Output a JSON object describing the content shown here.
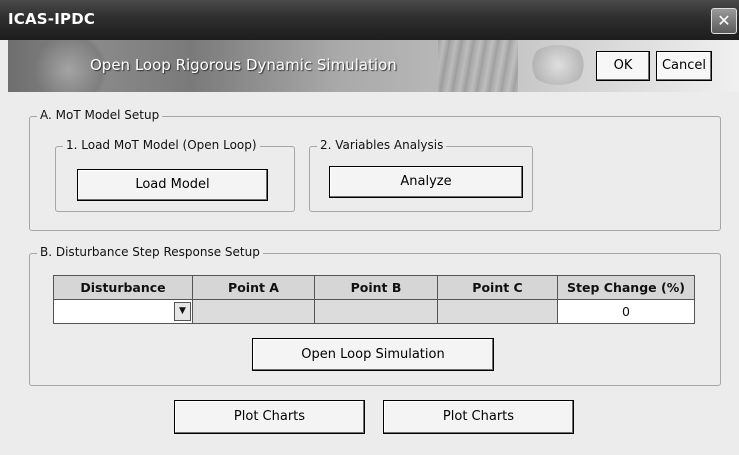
{
  "window": {
    "title": "ICAS-IPDC",
    "close_label": "✕"
  },
  "banner": {
    "title": "Open Loop Rigorous Dynamic Simulation",
    "ok_label": "OK",
    "cancel_label": "Cancel"
  },
  "section_a": {
    "legend": "A. MoT Model Setup",
    "load": {
      "legend": "1. Load MoT Model (Open Loop)",
      "button_label": "Load Model"
    },
    "analysis": {
      "legend": "2. Variables Analysis",
      "button_label": "Analyze"
    }
  },
  "section_b": {
    "legend": "B. Disturbance Step Response Setup",
    "columns": [
      "Disturbance",
      "Point A",
      "Point B",
      "Point C",
      "Step Change (%)"
    ],
    "row": {
      "disturbance": "",
      "point_a": "",
      "point_b": "",
      "point_c": "",
      "step_change": "0"
    },
    "simulate_label": "Open Loop Simulation"
  },
  "footer": {
    "plot1_label": "Plot Charts",
    "plot2_label": "Plot Charts"
  },
  "colors": {
    "title_bar": "#2e2e2e",
    "dialog_bg": "#ececec",
    "header_cell": "#d6d6d6"
  },
  "icons": {
    "close": "close-icon",
    "dropdown": "chevron-down-icon"
  }
}
